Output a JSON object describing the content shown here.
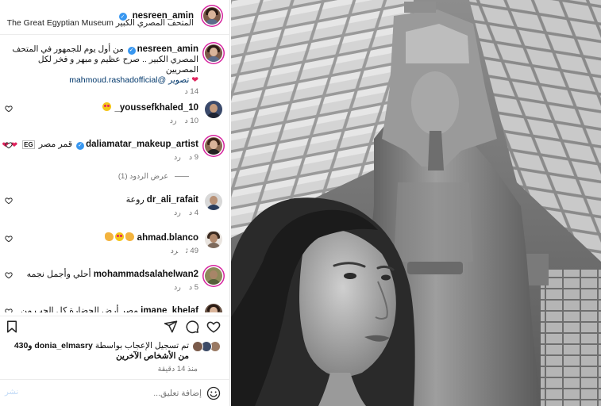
{
  "post": {
    "username": "nesreen_amin",
    "location": "The Great Egyptian Museum المتحف المصري الكبير",
    "caption_username": "nesreen_amin",
    "caption_line1": "من أول يوم للجمهور في المتحف",
    "caption_line2": "المصري الكبير .. صرح عظيم و مبهر و فخر لكل المصريين",
    "caption_line3": "تصوير @mahmoud.rashadofficial",
    "caption_time": "14 د"
  },
  "comments": [
    {
      "username": "youssefkhaled_10_",
      "text": "",
      "time": "10 د",
      "reply": "رد",
      "likes": ""
    },
    {
      "username": "daliamatar_makeup_artist",
      "text": "قمر مصر",
      "flag": "EG",
      "time": "9 د",
      "reply": "رد",
      "likes": ""
    },
    {
      "username": "dr_ali_rafait",
      "text": "روعة",
      "time": "4 د",
      "reply": "رد",
      "likes": ""
    },
    {
      "username": "ahmad.blanco",
      "text": "",
      "time": "49 ث",
      "reply": "رد",
      "likes": ""
    },
    {
      "username": "mohammadsalahelwan2",
      "text": "أحلي وأجمل نجمه",
      "time": "5 د",
      "reply": "رد",
      "likes": ""
    },
    {
      "username": "imane_khelaf",
      "text": "مصر أرض الحضارة كل الحب من",
      "time": "",
      "reply": "",
      "likes": ""
    }
  ],
  "view_replies": "عرض الردود (1)",
  "likes": {
    "prefix": "تم تسجيل الإعجاب بواسطة",
    "user": "donia_elmasry",
    "suffix": "و430 من الأشخاص الآخرين"
  },
  "time_ago": "منذ 14 دقيقة",
  "composer": {
    "placeholder": "إضافة تعليق...",
    "post_label": "نشر"
  },
  "icons": {
    "heart": "heart-icon",
    "comment": "comment-icon",
    "share": "share-icon",
    "save": "bookmark-icon",
    "emoji": "emoji-icon",
    "verified": "verified-badge-icon"
  },
  "colors": {
    "accent": "#3897f0",
    "link": "#00376b",
    "like_red": "#ed4956"
  }
}
